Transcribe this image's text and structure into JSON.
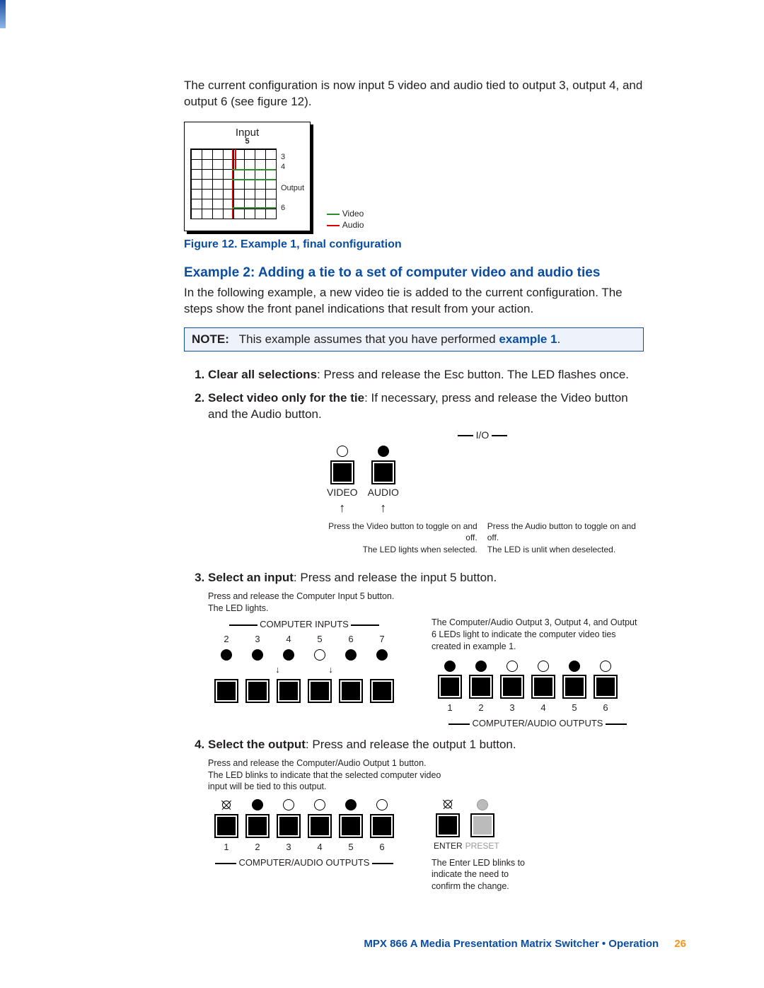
{
  "intro": "The current configuration is now input 5 video and audio tied to output 3, output 4, and output 6 (see figure 12).",
  "fig12": {
    "input_label": "Input",
    "output_label": "Output",
    "input_num": "5",
    "out_nums": [
      "3",
      "4",
      "6"
    ],
    "legend_video": "Video",
    "legend_audio": "Audio",
    "caption": "Figure 12.   Example 1, final configuration"
  },
  "example2_heading": "Example 2: Adding a tie to a set of computer video and audio ties",
  "example2_intro": "In the following example, a new video tie is added to the current configuration. The steps show the front panel indications that result from your action.",
  "note_label": "NOTE:",
  "note_text": "This example assumes that you have performed ",
  "note_link": "example 1",
  "step1_b": "Clear all selections",
  "step1_r": ": Press and release the Esc button. The LED flashes once.",
  "step2_b": "Select video only for the tie",
  "step2_r": ": If necessary, press and release the Video button and the Audio button.",
  "io": {
    "io": "I/O",
    "video": "VIDEO",
    "audio": "AUDIO",
    "v_cap1": "Press the Video button to toggle on and off.",
    "v_cap2": "The LED lights when selected.",
    "a_cap1": "Press the Audio button to toggle on and off.",
    "a_cap2": "The LED is unlit when deselected."
  },
  "step3_b": "Select an input",
  "step3_r": ": Press and release the input 5 button.",
  "step3": {
    "hint1": "Press and release the Computer Input 5 button.",
    "hint2": "The LED lights.",
    "inputs_label": "COMPUTER INPUTS",
    "in_nums": [
      "2",
      "3",
      "4",
      "5",
      "6",
      "7"
    ],
    "right_hint": "The Computer/Audio Output 3, Output 4, and Output 6 LEDs light to indicate the computer video ties created in example 1.",
    "out_nums": [
      "1",
      "2",
      "3",
      "4",
      "5",
      "6"
    ],
    "outputs_label": "COMPUTER/AUDIO OUTPUTS"
  },
  "step4_b": "Select the output",
  "step4_r": ": Press and release the output 1 button.",
  "step4": {
    "hint1": "Press and release the Computer/Audio Output 1 button.",
    "hint2": "The LED blinks to indicate that the selected computer video input will be tied to this output.",
    "out_nums": [
      "1",
      "2",
      "3",
      "4",
      "5",
      "6"
    ],
    "outputs_label": "COMPUTER/AUDIO OUTPUTS",
    "enter": "ENTER",
    "preset": "PRESET",
    "enter_hint": "The Enter LED blinks to indicate the need to confirm the change."
  },
  "footer_title": "MPX 866 A Media Presentation Matrix Switcher • Operation",
  "footer_page": "26"
}
